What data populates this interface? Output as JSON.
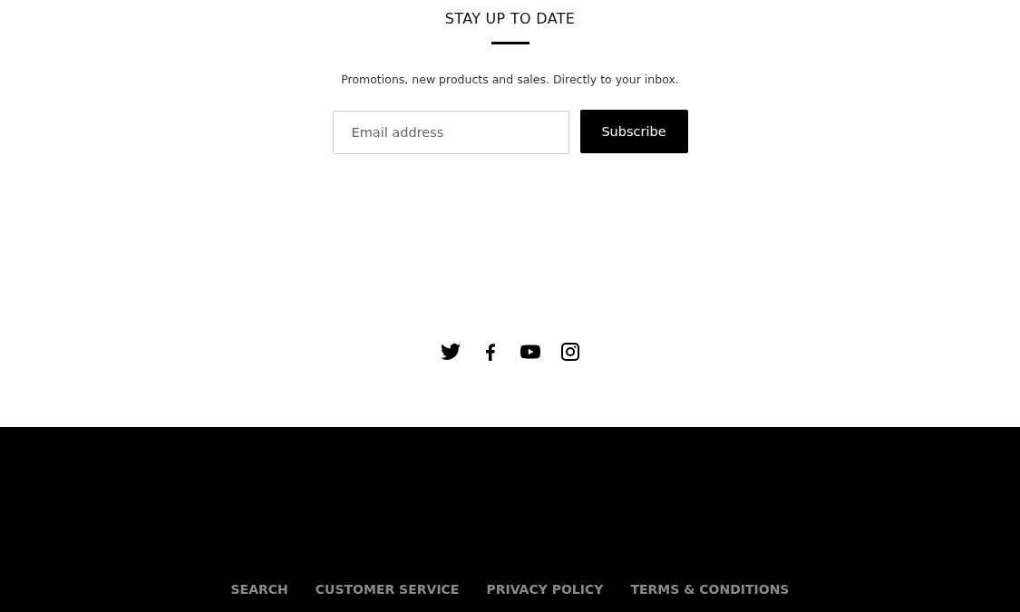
{
  "newsletter": {
    "title": "STAY UP TO DATE",
    "tagline": "Promotions, new products and sales. Directly to your inbox.",
    "email_field": {
      "placeholder": "Email address"
    },
    "button": "Subscribe"
  },
  "social_links": [
    {
      "kind": "twitter"
    },
    {
      "kind": "facebook"
    },
    {
      "kind": "youtube"
    },
    {
      "kind": "instagram"
    }
  ],
  "footer": {
    "links": [
      "SEARCH",
      "CUSTOMER SERVICE",
      "PRIVACY POLICY",
      "TERMS & CONDITIONS"
    ]
  }
}
